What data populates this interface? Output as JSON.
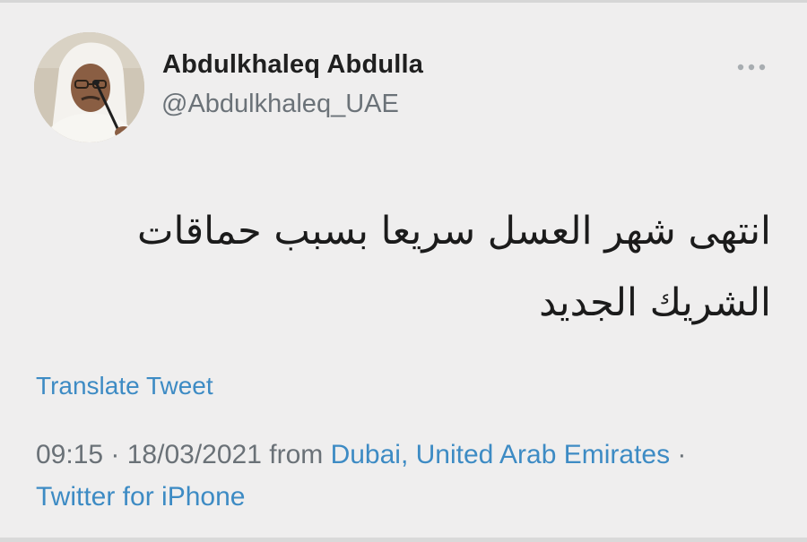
{
  "user": {
    "display_name": "Abdulkhaleq Abdulla",
    "handle": "@Abdulkhaleq_UAE",
    "avatar_icon": "profile-photo"
  },
  "tweet": {
    "text": "انتهى شهر العسل سريعا بسبب حماقات الشريك الجديد",
    "translate_label": "Translate Tweet"
  },
  "meta": {
    "time": "09:15",
    "sep1": " · ",
    "date": "18/03/2021",
    "from_label": " from ",
    "location": "Dubai, United Arab Emirates",
    "sep2": " · ",
    "source": "Twitter for iPhone"
  },
  "colors": {
    "link": "#3d8bc4",
    "muted": "#6a7177",
    "text": "#1f1f1f",
    "background": "#efeeee"
  },
  "icons": {
    "more": "more-horizontal-icon"
  }
}
